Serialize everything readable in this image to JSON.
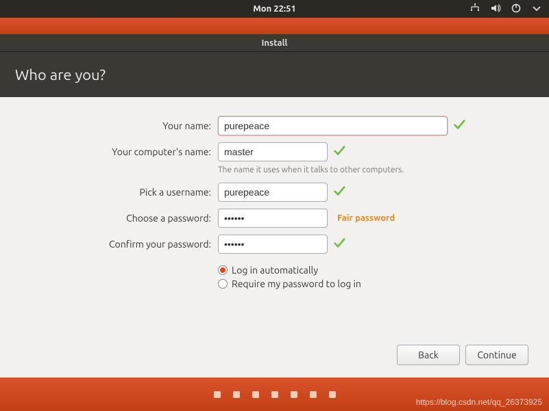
{
  "topbar": {
    "time": "Mon 22:51"
  },
  "window": {
    "title": "Install"
  },
  "header": {
    "title": "Who are you?"
  },
  "form": {
    "name_label": "Your name:",
    "name_value": "purepeace",
    "hostname_label": "Your computer's name:",
    "hostname_value": "master",
    "hostname_hint": "The name it uses when it talks to other computers.",
    "username_label": "Pick a username:",
    "username_value": "purepeace",
    "password_label": "Choose a password:",
    "password_value": "••••••",
    "password_strength": "Fair password",
    "confirm_label": "Confirm your password:",
    "confirm_value": "••••••",
    "radio_auto": "Log in automatically",
    "radio_require": "Require my password to log in",
    "radio_selected": "auto"
  },
  "buttons": {
    "back": "Back",
    "continue": "Continue"
  },
  "watermark": "https://blog.csdn.net/qq_26373925"
}
